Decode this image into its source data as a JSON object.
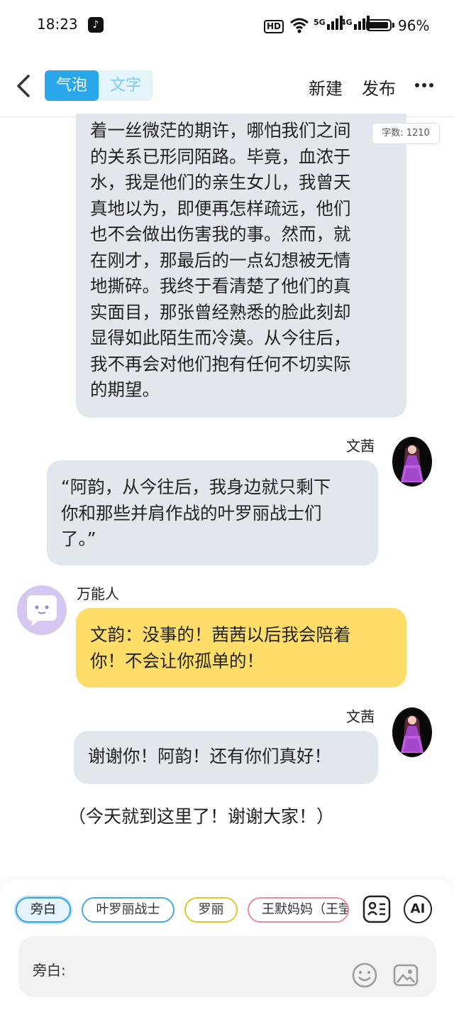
{
  "status_bar": {
    "time": "18:23",
    "app_icon": "tiktok-icon",
    "hd_label": "HD",
    "net1": "5G",
    "net2": "4G",
    "battery": "96%",
    "battery_level": 0.96
  },
  "header": {
    "tabs": [
      {
        "label": "气泡",
        "active": true
      },
      {
        "label": "文字",
        "active": false
      }
    ],
    "new_label": "新建",
    "publish_label": "发布",
    "more_icon": "more-icon",
    "back_icon": "back-icon"
  },
  "word_count": "字数: 1210",
  "messages": [
    {
      "lines": [
        "着一丝微茫的期许，哪怕我们之间",
        "的关系已形同陌路。毕竟，血浓于",
        "水，我是他们的亲生女儿，我曾天",
        "真地以为，即便再怎样疏远，他们",
        "也不会做出伤害我的事。然而，就",
        "在刚才，那最后的一点幻想被无情",
        "地撕碎。我终于看清楚了他们的真",
        "实面目，那张曾经熟悉的脸此刻却",
        "显得如此陌生而冷漠。从今往后，",
        "我不再会对他们抱有任何不切实际",
        "的期望。"
      ]
    },
    {
      "sender": "文茜",
      "lines": [
        "“阿韵，从今往后，我身边就只剩下",
        "你和那些并肩作战的叶罗丽战士们",
        "了。”"
      ]
    },
    {
      "sender": "万能人",
      "lines": [
        "文韵：没事的！茜茜以后我会陪着",
        "你！不会让你孤单的！"
      ]
    },
    {
      "sender": "文茜",
      "lines": [
        "谢谢你！阿韵！还有你们真好！"
      ]
    }
  ],
  "narration": "（今天就到这里了！谢谢大家！）",
  "roles": [
    "旁白",
    "叶罗丽战士",
    "罗丽",
    "王默妈妈（王莹"
  ],
  "input": {
    "label": "旁白:",
    "emoji_icon": "emoji-icon",
    "image_icon": "image-icon",
    "contact_icon": "character-card-icon",
    "ai_label": "AI"
  },
  "colors": {
    "accent": "#2aa7ea",
    "bubble_gray": "#e2e7ee",
    "bubble_yellow": "#fedd68"
  }
}
